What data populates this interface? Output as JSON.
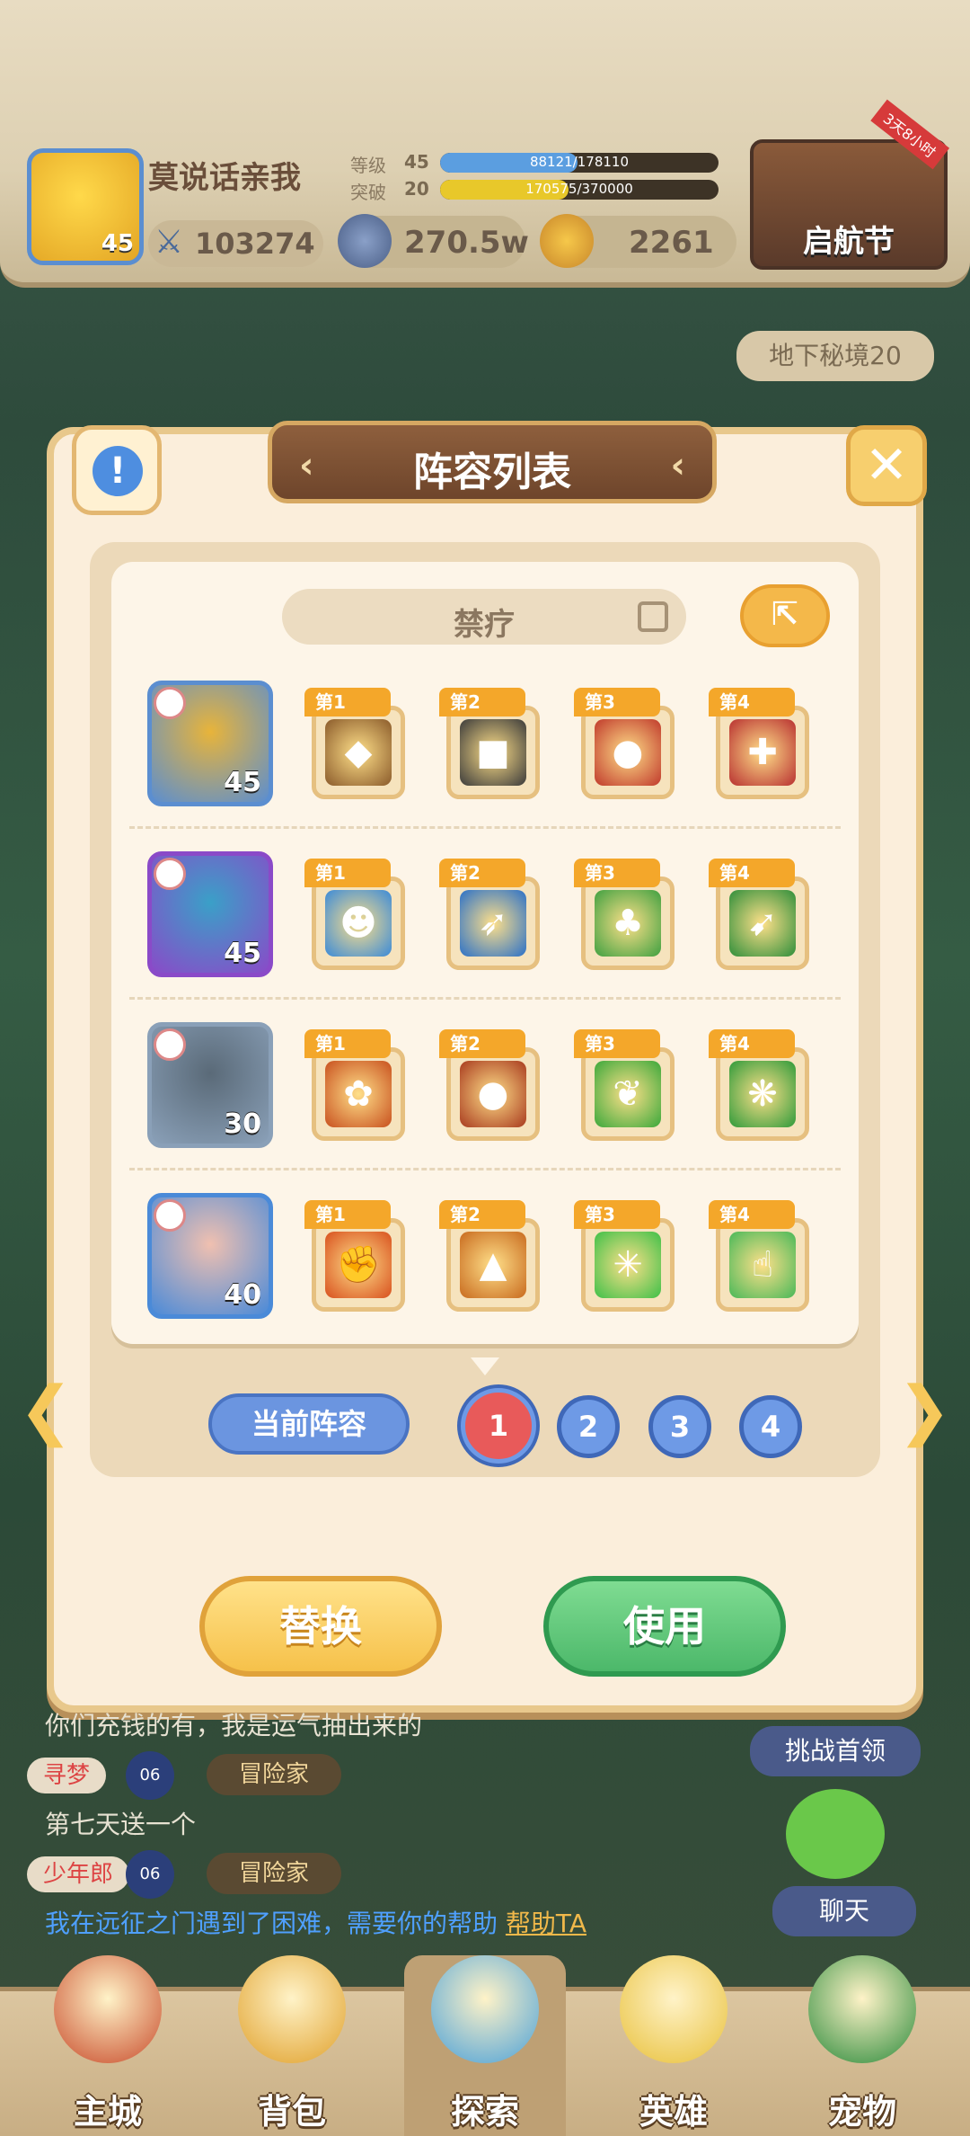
{
  "header": {
    "player_name": "莫说话亲我",
    "avatar_level": "45",
    "power": "103274",
    "level_label": "等级",
    "level_value": "45",
    "level_progress_text": "88121/178110",
    "level_progress": 0.495,
    "breakthrough_label": "突破",
    "breakthrough_value": "20",
    "breakthrough_progress_text": "170575/370000",
    "breakthrough_progress": 0.461,
    "coins": "270.5w",
    "gems": "2261",
    "event_label": "启航节",
    "event_ribbon": "3天8小时"
  },
  "side": {
    "dungeon_label": "地下秘境20",
    "challenge_label": "挑战首领",
    "chat_label": "聊天"
  },
  "modal": {
    "title": "阵容列表",
    "lineup_name": "禁疗",
    "rows": [
      {
        "level": "45",
        "hero_color": "#e8b43a",
        "frame": "#5b8ed0",
        "skills": [
          {
            "tag": "第1",
            "glyph": "◆",
            "color": "#8a5a2a"
          },
          {
            "tag": "第2",
            "glyph": "■",
            "color": "#3a3a3a"
          },
          {
            "tag": "第3",
            "glyph": "●",
            "color": "#c0392b"
          },
          {
            "tag": "第4",
            "glyph": "✚",
            "color": "#b83030"
          }
        ]
      },
      {
        "level": "45",
        "hero_color": "#3aa0c8",
        "frame": "#8a4ac8",
        "skills": [
          {
            "tag": "第1",
            "glyph": "☻",
            "color": "#3a8ad8"
          },
          {
            "tag": "第2",
            "glyph": "➶",
            "color": "#2a70c8"
          },
          {
            "tag": "第3",
            "glyph": "♣",
            "color": "#3ea040"
          },
          {
            "tag": "第4",
            "glyph": "➹",
            "color": "#2e8e3a"
          }
        ]
      },
      {
        "level": "30",
        "hero_color": "#5a6a78",
        "frame": "#8aa0b8",
        "skills": [
          {
            "tag": "第1",
            "glyph": "✿",
            "color": "#c8501e"
          },
          {
            "tag": "第2",
            "glyph": "●",
            "color": "#a83a1e"
          },
          {
            "tag": "第3",
            "glyph": "❦",
            "color": "#3aa83a"
          },
          {
            "tag": "第4",
            "glyph": "❋",
            "color": "#2e9a3a"
          }
        ]
      },
      {
        "level": "40",
        "hero_color": "#f0c0b0",
        "frame": "#4a8ad8",
        "skills": [
          {
            "tag": "第1",
            "glyph": "✊",
            "color": "#d8501e"
          },
          {
            "tag": "第2",
            "glyph": "▲",
            "color": "#c86a1e"
          },
          {
            "tag": "第3",
            "glyph": "✳",
            "color": "#3ec048"
          },
          {
            "tag": "第4",
            "glyph": "☝",
            "color": "#48b858"
          }
        ]
      }
    ],
    "current_lineup_label": "当前阵容",
    "slots": [
      "1",
      "2",
      "3",
      "4"
    ],
    "active_slot": "1",
    "replace_label": "替换",
    "use_label": "使用"
  },
  "chat": {
    "line1": "你们充钱的有，我是运气抽出来的",
    "user2": "寻梦",
    "user2_level": "06",
    "user2_title": "冒险家",
    "line2": "第七天送一个",
    "user3": "少年郎",
    "user3_level": "06",
    "user3_title": "冒险家",
    "line3": "我在远征之门遇到了困难，需要你的帮助",
    "help_link": "帮助TA"
  },
  "nav": [
    {
      "label": "主城",
      "color": "#c84a2a"
    },
    {
      "label": "背包",
      "color": "#e0a02a"
    },
    {
      "label": "探索",
      "color": "#4aa0d8"
    },
    {
      "label": "英雄",
      "color": "#e8c03a"
    },
    {
      "label": "宠物",
      "color": "#2a8a3a"
    }
  ]
}
